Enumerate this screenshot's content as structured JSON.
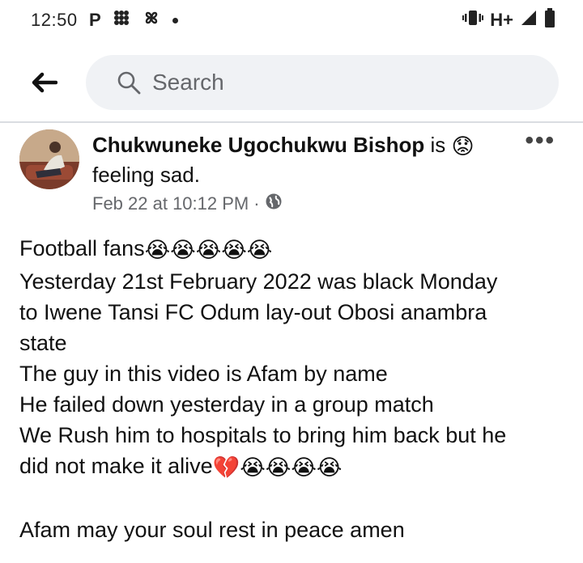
{
  "status_bar": {
    "time": "12:50",
    "left_icons": [
      "p-icon",
      "grid-icon",
      "pinwheel-icon",
      "dot-icon"
    ],
    "network": "H+",
    "right_icons": [
      "vibrate-icon",
      "network-icon",
      "signal-icon",
      "battery-icon"
    ]
  },
  "search": {
    "placeholder": "Search"
  },
  "post": {
    "author": "Chukwuneke Ugochukwu Bishop",
    "activity_prefix": "is",
    "activity": "feeling sad.",
    "feeling_emoji": "😟",
    "timestamp": "Feb 22 at 10:12 PM",
    "separator": "·",
    "privacy_icon": "globe-icon",
    "body_lines": [
      {
        "text": "Football fans",
        "emojis": "😭😭😭😭😭"
      },
      {
        "text": "Yesterday 21st February 2022 was black Monday",
        "emojis": ""
      },
      {
        "text": "to Iwene Tansi FC Odum lay-out Obosi anambra",
        "emojis": ""
      },
      {
        "text": "state",
        "emojis": ""
      },
      {
        "text": "The guy in this video is Afam by name",
        "emojis": ""
      },
      {
        "text": "He failed down yesterday in a group match",
        "emojis": ""
      },
      {
        "text": "We Rush him to hospitals to bring him back but he",
        "emojis": ""
      },
      {
        "text": "did not make it alive",
        "emojis": "💔😭😭😭😭"
      },
      {
        "text": "",
        "emojis": ""
      },
      {
        "text": "Afam may your soul rest in peace amen",
        "emojis": ""
      }
    ]
  }
}
